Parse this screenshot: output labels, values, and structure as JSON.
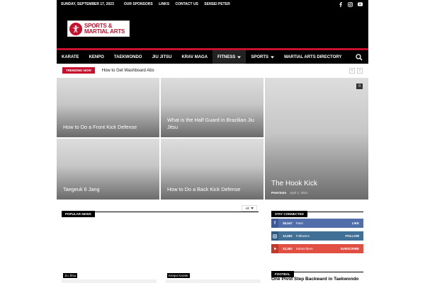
{
  "topbar": {
    "date": "SUNDAY, SEPTEMBER 17, 2023",
    "menu": [
      "OUR SPONSORS",
      "LINKS",
      "CONTACT US",
      "SENSEI PETER"
    ],
    "socials": [
      "facebook-icon",
      "instagram-icon",
      "youtube-icon"
    ]
  },
  "logo": {
    "line1": "SPORTS &",
    "line2": "MARTIAL ARTS"
  },
  "nav": {
    "items": [
      "KARATE",
      "KENPO",
      "TAEKWONDO",
      "JIU JITSU",
      "KRAV MAGA",
      "FITNESS",
      "SPORTS",
      "MARTIAL ARTS DIRECTORY"
    ],
    "active": "FITNESS"
  },
  "trending": {
    "badge": "TRENDING NOW",
    "title": "How to Get Washboard Abs"
  },
  "grid": {
    "t1": "How to Do a Front Kick Defense",
    "t2": "What is the Half Guard in Brazilian Jiu Jitsu",
    "t3": "Taegeuk 6 Jang",
    "t4": "How to Do a Back Kick Defense",
    "t5": {
      "title": "The Hook Kick",
      "author": "PeterSoto",
      "date": "April 1, 2021",
      "comments": "0"
    }
  },
  "popular": {
    "heading": "POPULAR NEWS",
    "filter": "All",
    "tags": [
      "Jiu Jitsu",
      "Kenpo Karate"
    ]
  },
  "connected": {
    "heading": "STAY CONNECTED",
    "rows": [
      {
        "count": "36,547",
        "label": "Fans",
        "action": "LIKE"
      },
      {
        "count": "12,652",
        "label": "Followers",
        "action": "FOLLOW"
      },
      {
        "count": "22,362",
        "label": "Subscribers",
        "action": "SUBSCRIBE"
      }
    ]
  },
  "footbal": {
    "heading": "FOOTBAL",
    "article": "One Pivot Step Backward in Taekwondo"
  },
  "colors": {
    "accent": "#c8102e",
    "facebook": "#516eab",
    "instagram": "#417096",
    "youtube": "#e14e42"
  }
}
